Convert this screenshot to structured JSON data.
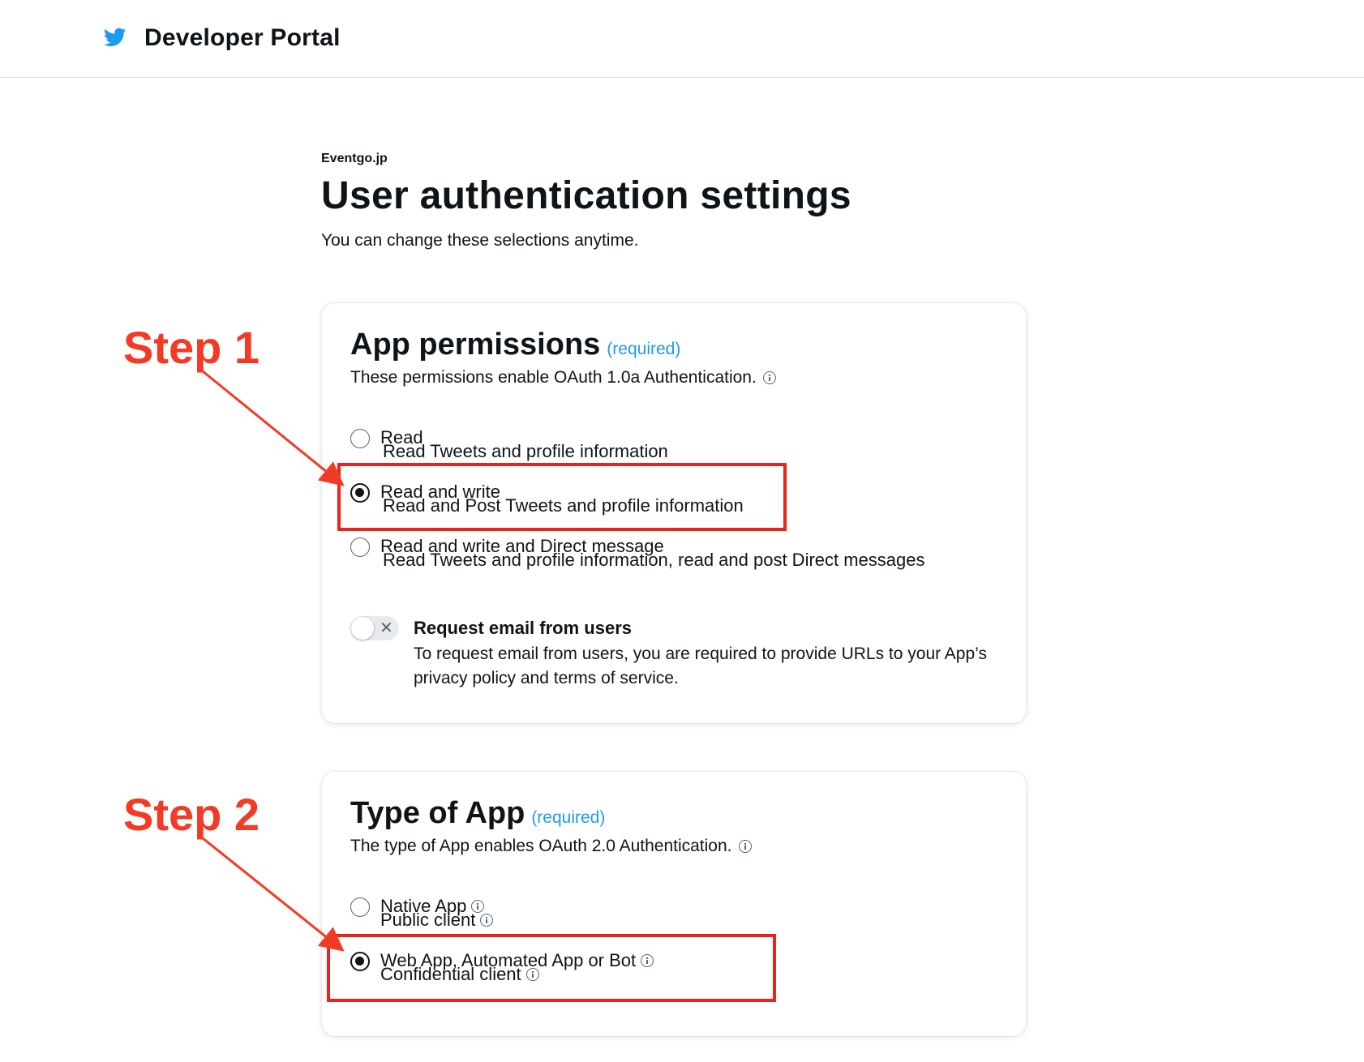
{
  "header": {
    "title": "Developer Portal",
    "logo_icon": "twitter-bird-icon",
    "brand_color": "#1d9bf0"
  },
  "page": {
    "app_name": "Eventgo.jp",
    "title": "User authentication settings",
    "subtitle": "You can change these selections anytime."
  },
  "app_permissions": {
    "title": "App permissions",
    "required": "(required)",
    "description": "These permissions enable OAuth 1.0a Authentication.",
    "options": [
      {
        "label": "Read",
        "description": "Read Tweets and profile information",
        "selected": false
      },
      {
        "label": "Read and write",
        "description": "Read and Post Tweets and profile information",
        "selected": true
      },
      {
        "label": "Read and write and Direct message",
        "description": "Read Tweets and profile information, read and post Direct messages",
        "selected": false
      }
    ],
    "email_toggle": {
      "label": "Request email from users",
      "description": "To request email from users, you are required to provide URLs to your App’s privacy policy and terms of service.",
      "enabled": false
    }
  },
  "type_of_app": {
    "title": "Type of App",
    "required": "(required)",
    "description": "The type of App enables OAuth 2.0 Authentication.",
    "options": [
      {
        "label": "Native App",
        "description": "Public client",
        "selected": false
      },
      {
        "label": "Web App, Automated App or Bot",
        "description": "Confidential client",
        "selected": true
      }
    ]
  },
  "annotations": {
    "step1": "Step 1",
    "step2": "Step 2",
    "color": "#f23a24"
  }
}
